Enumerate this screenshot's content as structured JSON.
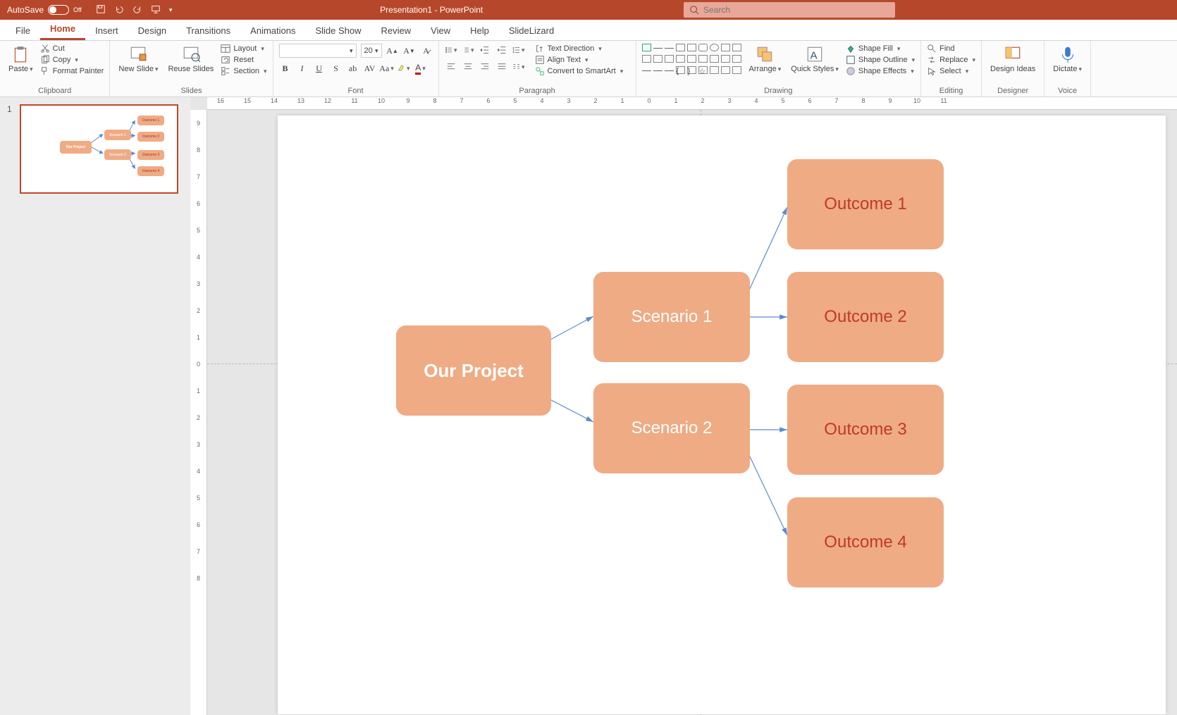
{
  "titlebar": {
    "autosave_label": "AutoSave",
    "autosave_state": "Off",
    "title": "Presentation1 - PowerPoint",
    "search_placeholder": "Search"
  },
  "tabs": [
    "File",
    "Home",
    "Insert",
    "Design",
    "Transitions",
    "Animations",
    "Slide Show",
    "Review",
    "View",
    "Help",
    "SlideLizard"
  ],
  "active_tab": "Home",
  "ribbon": {
    "clipboard": {
      "paste": "Paste",
      "cut": "Cut",
      "copy": "Copy",
      "format_painter": "Format Painter",
      "label": "Clipboard"
    },
    "slides": {
      "new_slide": "New Slide",
      "reuse": "Reuse Slides",
      "layout": "Layout",
      "reset": "Reset",
      "section": "Section",
      "label": "Slides"
    },
    "font": {
      "name": "",
      "size": "20",
      "label": "Font"
    },
    "paragraph": {
      "text_direction": "Text Direction",
      "align_text": "Align Text",
      "convert_smartart": "Convert to SmartArt",
      "label": "Paragraph"
    },
    "drawing": {
      "arrange": "Arrange",
      "quick_styles": "Quick Styles",
      "shape_fill": "Shape Fill",
      "shape_outline": "Shape Outline",
      "shape_effects": "Shape Effects",
      "label": "Drawing"
    },
    "editing": {
      "find": "Find",
      "replace": "Replace",
      "select": "Select",
      "label": "Editing"
    },
    "designer": {
      "design_ideas": "Design Ideas",
      "label": "Designer"
    },
    "voice": {
      "dictate": "Dictate",
      "label": "Voice"
    }
  },
  "thumb_number": "1",
  "ruler_h": [
    "16",
    "15",
    "14",
    "13",
    "12",
    "11",
    "10",
    "9",
    "8",
    "7",
    "6",
    "5",
    "4",
    "3",
    "2",
    "1",
    "0",
    "1",
    "2",
    "3",
    "4",
    "5",
    "6",
    "7",
    "8",
    "9",
    "10",
    "11"
  ],
  "ruler_v": [
    "9",
    "8",
    "7",
    "6",
    "5",
    "4",
    "3",
    "2",
    "1",
    "0",
    "1",
    "2",
    "3",
    "4",
    "5",
    "6",
    "7",
    "8"
  ],
  "diagram": {
    "root": "Our Project",
    "scenarios": [
      "Scenario 1",
      "Scenario 2"
    ],
    "outcomes": [
      "Outcome 1",
      "Outcome 2",
      "Outcome 3",
      "Outcome 4"
    ]
  },
  "chart_data": {
    "type": "diagram",
    "nodes": [
      {
        "id": "root",
        "label": "Our Project"
      },
      {
        "id": "s1",
        "label": "Scenario 1"
      },
      {
        "id": "s2",
        "label": "Scenario 2"
      },
      {
        "id": "o1",
        "label": "Outcome 1"
      },
      {
        "id": "o2",
        "label": "Outcome 2"
      },
      {
        "id": "o3",
        "label": "Outcome 3"
      },
      {
        "id": "o4",
        "label": "Outcome 4"
      }
    ],
    "edges": [
      [
        "root",
        "s1"
      ],
      [
        "root",
        "s2"
      ],
      [
        "s1",
        "o1"
      ],
      [
        "s1",
        "o2"
      ],
      [
        "s2",
        "o3"
      ],
      [
        "s2",
        "o4"
      ]
    ]
  }
}
